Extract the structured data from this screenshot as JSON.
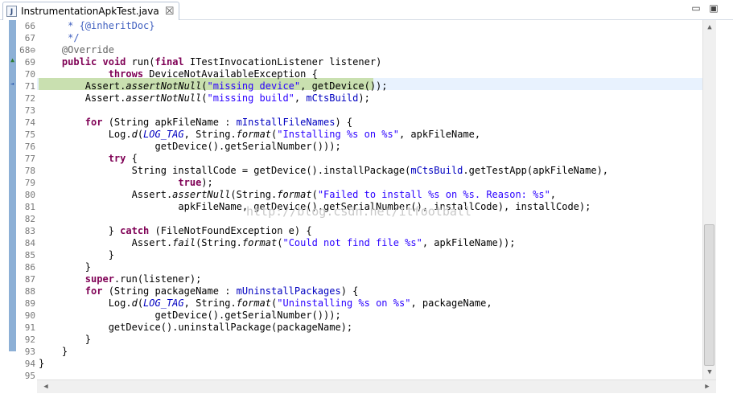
{
  "tab": {
    "title": "InstrumentationApkTest.java",
    "icon": "java-file-icon",
    "close_glyph": "☒"
  },
  "window": {
    "minimize_glyph": "▭",
    "maximize_glyph": "▣"
  },
  "watermark": "http://blog.csdn.net/itfootball",
  "editor": {
    "highlight_line": "71",
    "colors": {
      "keyword": "#7f0055",
      "string": "#2a00ff",
      "field": "#0000c0",
      "annotation": "#646464",
      "comment": "#3f5fbf",
      "current_line": "#e8f2fe",
      "selection": "#c9e0b0"
    },
    "lines": [
      {
        "n": "66",
        "segs": [
          {
            "t": "     * ",
            "c": "com"
          },
          {
            "t": "{@inheritDoc}",
            "c": "com"
          }
        ]
      },
      {
        "n": "67",
        "segs": [
          {
            "t": "     */",
            "c": "com"
          }
        ]
      },
      {
        "n": "68⊖",
        "segs": [
          {
            "t": "    @Override",
            "c": "ann"
          }
        ]
      },
      {
        "n": "69",
        "segs": [
          {
            "t": "    ",
            "c": ""
          },
          {
            "t": "public",
            "c": "kw"
          },
          {
            "t": " ",
            "c": ""
          },
          {
            "t": "void",
            "c": "kw"
          },
          {
            "t": " run(",
            "c": ""
          },
          {
            "t": "final",
            "c": "kw"
          },
          {
            "t": " ITestInvocationListener listener)",
            "c": ""
          }
        ]
      },
      {
        "n": "70",
        "segs": [
          {
            "t": "            ",
            "c": ""
          },
          {
            "t": "throws",
            "c": "kw"
          },
          {
            "t": " DeviceNotAvailableException {",
            "c": ""
          }
        ]
      },
      {
        "n": "71",
        "segs": [
          {
            "t": "        Assert.",
            "c": ""
          },
          {
            "t": "assertNotNull",
            "c": "it"
          },
          {
            "t": "(",
            "c": ""
          },
          {
            "t": "\"missing device\"",
            "c": "str"
          },
          {
            "t": ", getDevice());",
            "c": ""
          }
        ]
      },
      {
        "n": "72",
        "segs": [
          {
            "t": "        Assert.",
            "c": ""
          },
          {
            "t": "assertNotNull",
            "c": "it"
          },
          {
            "t": "(",
            "c": ""
          },
          {
            "t": "\"missing build\"",
            "c": "str"
          },
          {
            "t": ", ",
            "c": ""
          },
          {
            "t": "mCtsBuild",
            "c": "fld"
          },
          {
            "t": ");",
            "c": ""
          }
        ]
      },
      {
        "n": "73",
        "segs": []
      },
      {
        "n": "74",
        "segs": [
          {
            "t": "        ",
            "c": ""
          },
          {
            "t": "for",
            "c": "kw"
          },
          {
            "t": " (String apkFileName : ",
            "c": ""
          },
          {
            "t": "mInstallFileNames",
            "c": "fld"
          },
          {
            "t": ") {",
            "c": ""
          }
        ]
      },
      {
        "n": "75",
        "segs": [
          {
            "t": "            Log.",
            "c": ""
          },
          {
            "t": "d",
            "c": "it"
          },
          {
            "t": "(",
            "c": ""
          },
          {
            "t": "LOG_TAG",
            "c": "fld it"
          },
          {
            "t": ", String.",
            "c": ""
          },
          {
            "t": "format",
            "c": "it"
          },
          {
            "t": "(",
            "c": ""
          },
          {
            "t": "\"Installing %s on %s\"",
            "c": "str"
          },
          {
            "t": ", apkFileName,",
            "c": ""
          }
        ]
      },
      {
        "n": "76",
        "segs": [
          {
            "t": "                    getDevice().getSerialNumber()));",
            "c": ""
          }
        ]
      },
      {
        "n": "77",
        "segs": [
          {
            "t": "            ",
            "c": ""
          },
          {
            "t": "try",
            "c": "kw"
          },
          {
            "t": " {",
            "c": ""
          }
        ]
      },
      {
        "n": "78",
        "segs": [
          {
            "t": "                String installCode = getDevice().installPackage(",
            "c": ""
          },
          {
            "t": "mCtsBuild",
            "c": "fld"
          },
          {
            "t": ".getTestApp(apkFileName),",
            "c": ""
          }
        ]
      },
      {
        "n": "79",
        "segs": [
          {
            "t": "                        ",
            "c": ""
          },
          {
            "t": "true",
            "c": "kw"
          },
          {
            "t": ");",
            "c": ""
          }
        ]
      },
      {
        "n": "80",
        "segs": [
          {
            "t": "                Assert.",
            "c": ""
          },
          {
            "t": "assertNull",
            "c": "it"
          },
          {
            "t": "(String.",
            "c": ""
          },
          {
            "t": "format",
            "c": "it"
          },
          {
            "t": "(",
            "c": ""
          },
          {
            "t": "\"Failed to install %s on %s. Reason: %s\"",
            "c": "str"
          },
          {
            "t": ",",
            "c": ""
          }
        ]
      },
      {
        "n": "81",
        "segs": [
          {
            "t": "                        apkFileName, getDevice().getSerialNumber(), installCode), installCode);",
            "c": ""
          }
        ]
      },
      {
        "n": "82",
        "segs": []
      },
      {
        "n": "83",
        "segs": [
          {
            "t": "            } ",
            "c": ""
          },
          {
            "t": "catch",
            "c": "kw"
          },
          {
            "t": " (FileNotFoundException e) {",
            "c": ""
          }
        ]
      },
      {
        "n": "84",
        "segs": [
          {
            "t": "                Assert.",
            "c": ""
          },
          {
            "t": "fail",
            "c": "it"
          },
          {
            "t": "(String.",
            "c": ""
          },
          {
            "t": "format",
            "c": "it"
          },
          {
            "t": "(",
            "c": ""
          },
          {
            "t": "\"Could not find file %s\"",
            "c": "str"
          },
          {
            "t": ", apkFileName));",
            "c": ""
          }
        ]
      },
      {
        "n": "85",
        "segs": [
          {
            "t": "            }",
            "c": ""
          }
        ]
      },
      {
        "n": "86",
        "segs": [
          {
            "t": "        }",
            "c": ""
          }
        ]
      },
      {
        "n": "87",
        "segs": [
          {
            "t": "        ",
            "c": ""
          },
          {
            "t": "super",
            "c": "kw"
          },
          {
            "t": ".run(listener);",
            "c": ""
          }
        ]
      },
      {
        "n": "88",
        "segs": [
          {
            "t": "        ",
            "c": ""
          },
          {
            "t": "for",
            "c": "kw"
          },
          {
            "t": " (String packageName : ",
            "c": ""
          },
          {
            "t": "mUninstallPackages",
            "c": "fld"
          },
          {
            "t": ") {",
            "c": ""
          }
        ]
      },
      {
        "n": "89",
        "segs": [
          {
            "t": "            Log.",
            "c": ""
          },
          {
            "t": "d",
            "c": "it"
          },
          {
            "t": "(",
            "c": ""
          },
          {
            "t": "LOG_TAG",
            "c": "fld it"
          },
          {
            "t": ", String.",
            "c": ""
          },
          {
            "t": "format",
            "c": "it"
          },
          {
            "t": "(",
            "c": ""
          },
          {
            "t": "\"Uninstalling %s on %s\"",
            "c": "str"
          },
          {
            "t": ", packageName,",
            "c": ""
          }
        ]
      },
      {
        "n": "90",
        "segs": [
          {
            "t": "                    getDevice().getSerialNumber()));",
            "c": ""
          }
        ]
      },
      {
        "n": "91",
        "segs": [
          {
            "t": "            getDevice().uninstallPackage(packageName);",
            "c": ""
          }
        ]
      },
      {
        "n": "92",
        "segs": [
          {
            "t": "        }",
            "c": ""
          }
        ]
      },
      {
        "n": "93",
        "segs": [
          {
            "t": "    }",
            "c": ""
          }
        ]
      },
      {
        "n": "94",
        "segs": [
          {
            "t": "}",
            "c": ""
          }
        ]
      },
      {
        "n": "95",
        "segs": []
      }
    ]
  }
}
